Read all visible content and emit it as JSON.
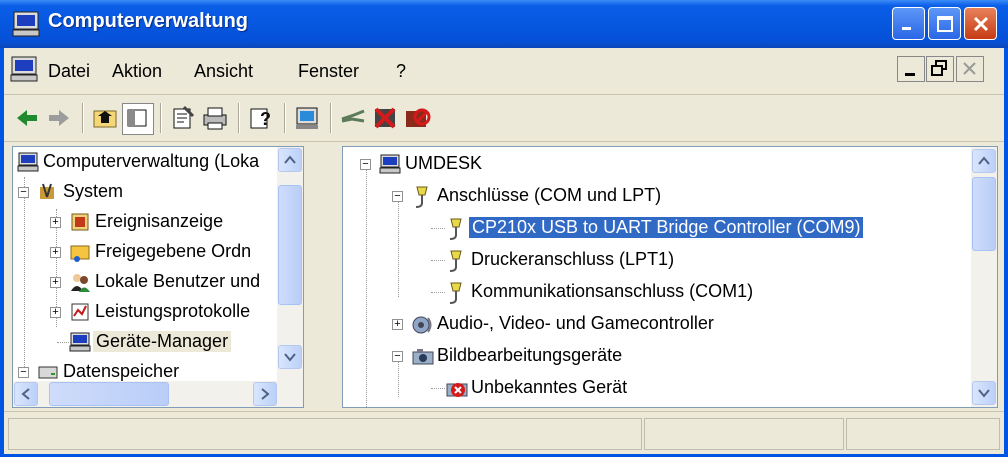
{
  "window": {
    "title": "Computerverwaltung"
  },
  "menu": {
    "items": [
      {
        "label": "Datei"
      },
      {
        "label": "Aktion"
      },
      {
        "label": "Ansicht"
      },
      {
        "label": "Fenster"
      },
      {
        "label": "?"
      }
    ]
  },
  "left_tree": {
    "items": [
      {
        "label": "Computerverwaltung (Loka"
      },
      {
        "label": "System"
      },
      {
        "label": "Ereignisanzeige"
      },
      {
        "label": "Freigegebene Ordn"
      },
      {
        "label": "Lokale Benutzer und"
      },
      {
        "label": "Leistungsprotokolle"
      },
      {
        "label": "Geräte-Manager"
      },
      {
        "label": "Datenspeicher"
      }
    ]
  },
  "right_tree": {
    "items": [
      {
        "label": "UMDESK"
      },
      {
        "label": "Anschlüsse (COM und LPT)"
      },
      {
        "label": "CP210x USB to UART Bridge Controller (COM9)"
      },
      {
        "label": "Druckeranschluss (LPT1)"
      },
      {
        "label": "Kommunikationsanschluss (COM1)"
      },
      {
        "label": "Audio-, Video- und Gamecontroller"
      },
      {
        "label": "Bildbearbeitungsgeräte"
      },
      {
        "label": "Unbekanntes Gerät"
      }
    ]
  },
  "colors": {
    "titlebar": "#0a5ee8",
    "selection": "#316ac5",
    "face": "#ece9d8"
  }
}
